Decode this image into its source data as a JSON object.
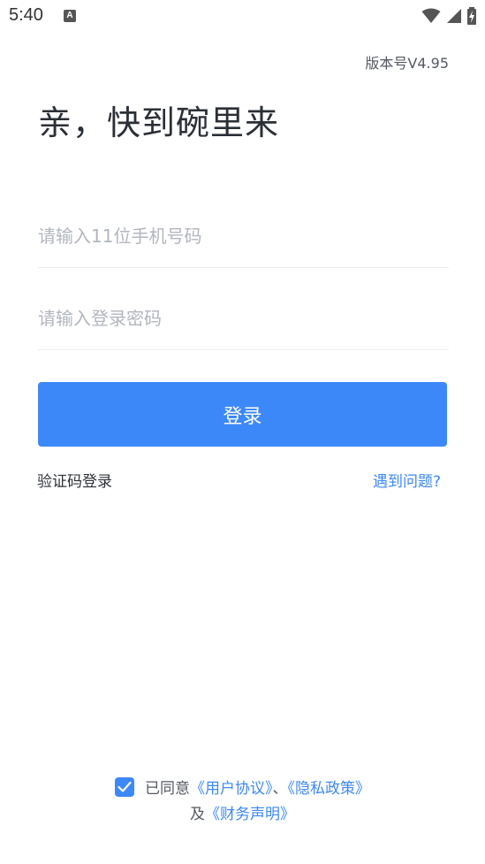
{
  "status_bar": {
    "time": "5:40",
    "notification_icon": "A"
  },
  "version": "版本号V4.95",
  "greeting": "亲，快到碗里来",
  "phone_input": {
    "placeholder": "请输入11位手机号码",
    "value": ""
  },
  "password_input": {
    "placeholder": "请输入登录密码",
    "value": ""
  },
  "login_button": "登录",
  "sms_login": "验证码登录",
  "problem_link": "遇到问题?",
  "agreement": {
    "checked": true,
    "prefix": "已同意",
    "user_agreement": "《用户协议》",
    "separator": "、",
    "privacy_policy": "《隐私政策》",
    "and": "及",
    "financial_statement": "《财务声明》"
  },
  "colors": {
    "accent": "#3d88f9",
    "text_primary": "#2b2f36",
    "placeholder": "#b2b6bd"
  }
}
